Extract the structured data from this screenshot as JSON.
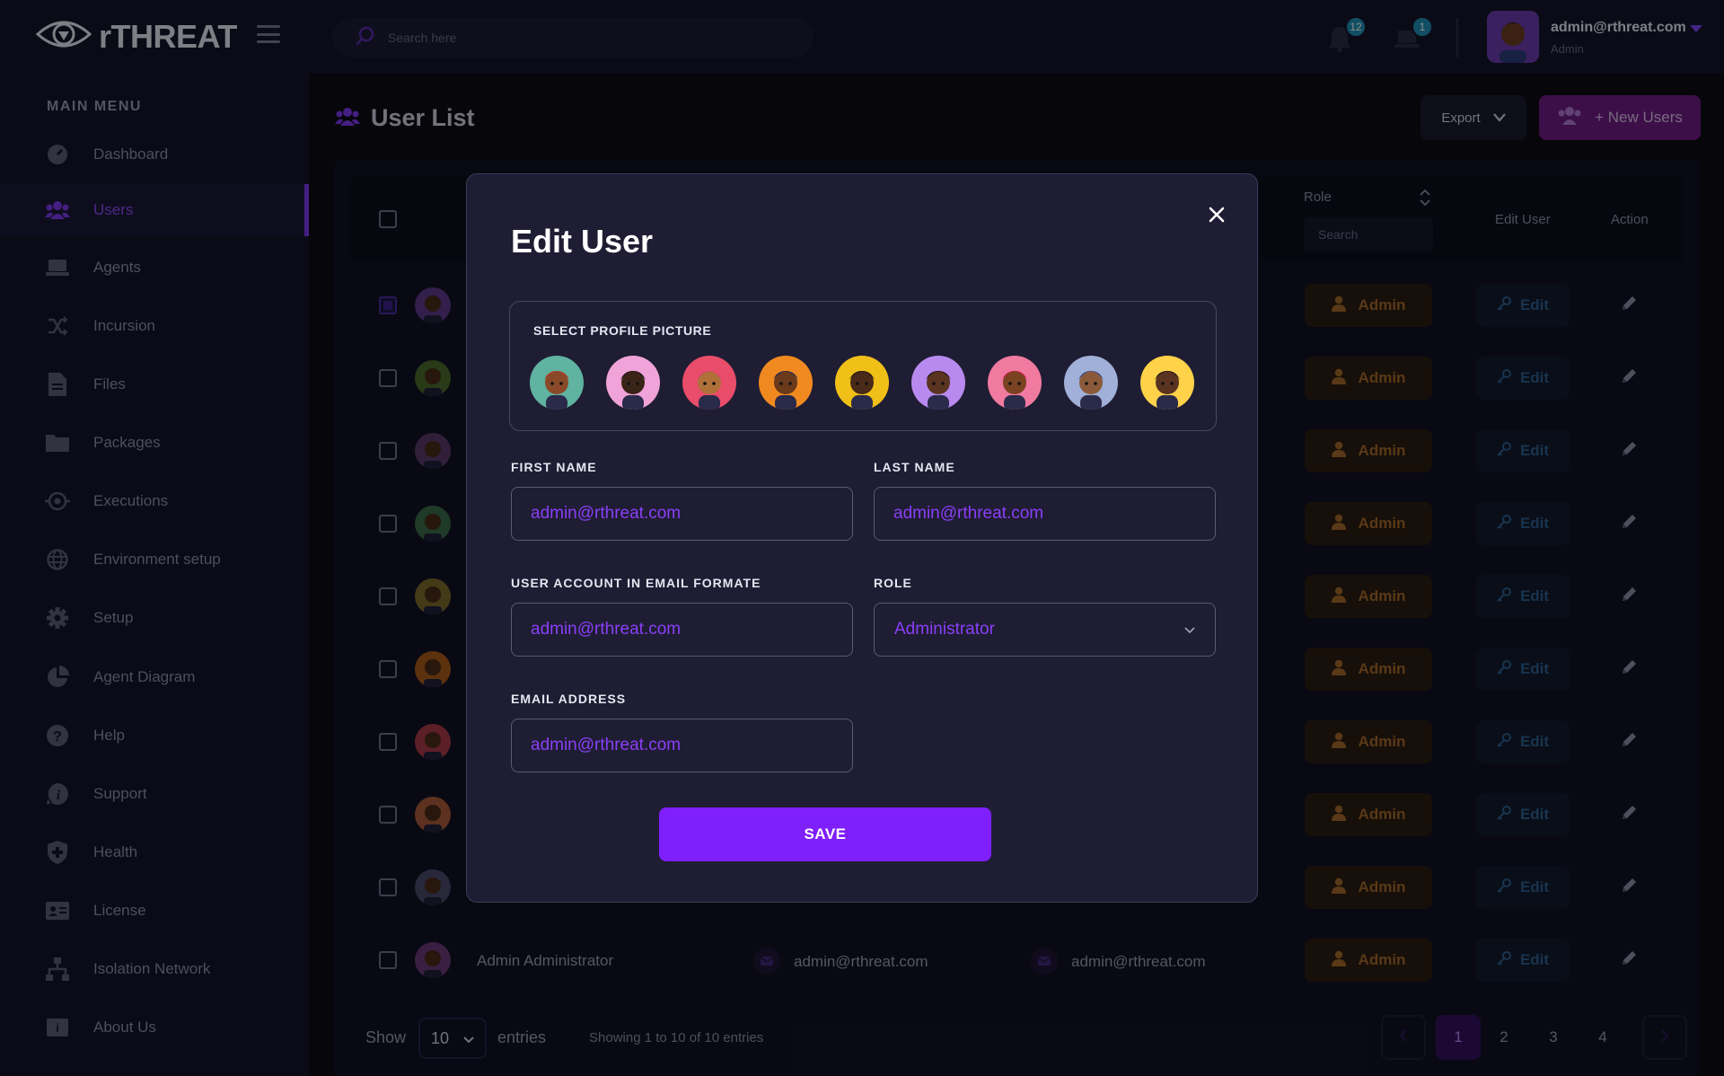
{
  "app": {
    "logo_text": "rTHREAT"
  },
  "topbar": {
    "search_placeholder": "Search here",
    "notifications": [
      {
        "icon": "bell-icon",
        "count": "12"
      },
      {
        "icon": "laptop-icon",
        "count": "1"
      }
    ],
    "user": {
      "name": "admin@rthreat.com",
      "role": "Admin"
    }
  },
  "sidebar": {
    "title": "MAIN MENU",
    "items": [
      {
        "label": "Dashboard",
        "icon": "dashboard-icon",
        "active": false
      },
      {
        "label": "Users",
        "icon": "users-icon",
        "active": true
      },
      {
        "label": "Agents",
        "icon": "laptop-icon",
        "active": false
      },
      {
        "label": "Incursion",
        "icon": "shuffle-icon",
        "active": false
      },
      {
        "label": "Files",
        "icon": "file-icon",
        "active": false
      },
      {
        "label": "Packages",
        "icon": "folder-icon",
        "active": false
      },
      {
        "label": "Executions",
        "icon": "target-icon",
        "active": false
      },
      {
        "label": "Environment setup",
        "icon": "globe-icon",
        "active": false
      },
      {
        "label": "Setup",
        "icon": "gear-icon",
        "active": false
      },
      {
        "label": "Agent Diagram",
        "icon": "pie-chart-icon",
        "active": false
      },
      {
        "label": "Help",
        "icon": "help-icon",
        "active": false
      },
      {
        "label": "Support",
        "icon": "info-icon",
        "active": false
      },
      {
        "label": "Health",
        "icon": "shield-icon",
        "active": false
      },
      {
        "label": "License",
        "icon": "id-card-icon",
        "active": false
      },
      {
        "label": "Isolation Network",
        "icon": "network-icon",
        "active": false
      },
      {
        "label": "About Us",
        "icon": "about-icon",
        "active": false
      }
    ]
  },
  "page": {
    "title": "User List",
    "export_label": "Export",
    "new_users_label": "+ New Users"
  },
  "table": {
    "headers": {
      "role": "Role",
      "edit_user": "Edit User",
      "action": "Action"
    },
    "role_search_placeholder": "Search",
    "admin_label": "Admin",
    "edit_label": "Edit",
    "last_row": {
      "name": "Admin Administrator",
      "account": "admin@rthreat.com",
      "email": "admin@rthreat.com"
    }
  },
  "pagination": {
    "show_label": "Show",
    "entries_value": "10",
    "entries_label": "entries",
    "showing_text": "Showing 1 to 10 of 10 entries",
    "pages": [
      "1",
      "2",
      "3",
      "4"
    ]
  },
  "modal": {
    "title": "Edit User",
    "profile_picture_label": "SELECT PROFILE PICTURE",
    "first_name_label": "FIRST NAME",
    "first_name_value": "admin@rthreat.com",
    "last_name_label": "LAST NAME",
    "last_name_value": "admin@rthreat.com",
    "account_label": "USER ACCOUNT IN EMAIL FORMATE",
    "account_value": "admin@rthreat.com",
    "role_label": "ROLE",
    "role_value": "Administrator",
    "email_label": "EMAIL ADDRESS",
    "email_value": "admin@rthreat.com",
    "save_label": "SAVE"
  },
  "colors": {
    "accent": "#7f1ffb",
    "accent_text": "#8a3ff7",
    "admin_badge": "#a2692a",
    "edit_badge": "#2f5f91"
  }
}
